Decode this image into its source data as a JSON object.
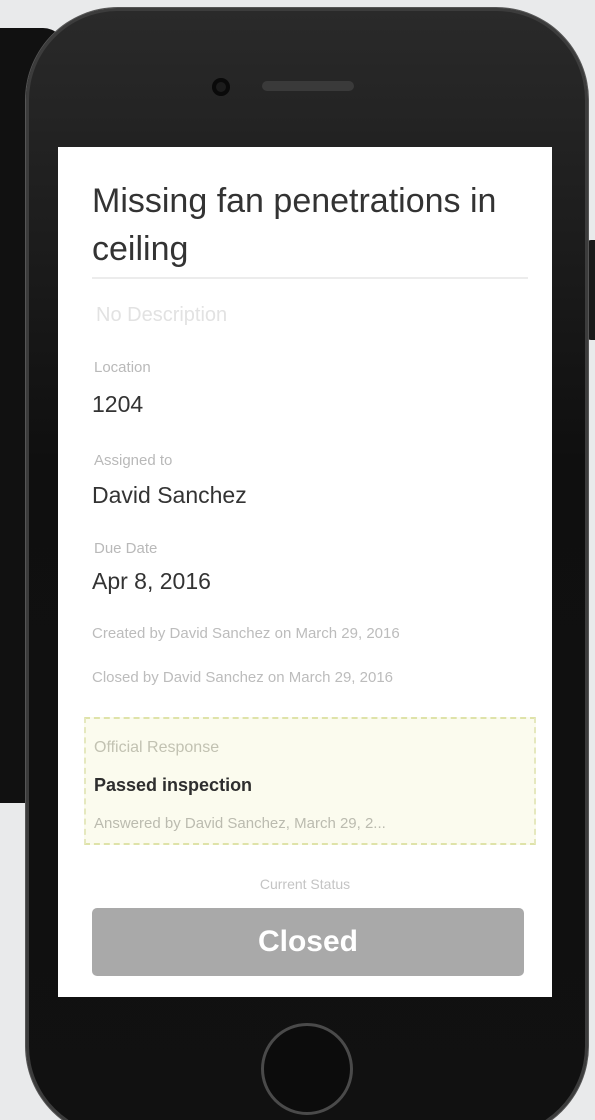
{
  "issue": {
    "title": "Missing fan penetrations in ceiling",
    "description_placeholder": "No Description",
    "fields": {
      "location": {
        "label": "Location",
        "value": "1204"
      },
      "assigned_to": {
        "label": "Assigned to",
        "value": "David Sanchez"
      },
      "due_date": {
        "label": "Due Date",
        "value": "Apr 8, 2016"
      }
    },
    "created_text": "Created by David Sanchez on March 29, 2016",
    "closed_text": "Closed by David Sanchez on March 29, 2016"
  },
  "official_response": {
    "label": "Official Response",
    "text": "Passed inspection",
    "answered_text": "Answered by David Sanchez, March 29, 2..."
  },
  "status": {
    "label": "Current Status",
    "value": "Closed"
  },
  "colors": {
    "status_button": "#a9a9a9",
    "response_background": "#fbfbee"
  }
}
